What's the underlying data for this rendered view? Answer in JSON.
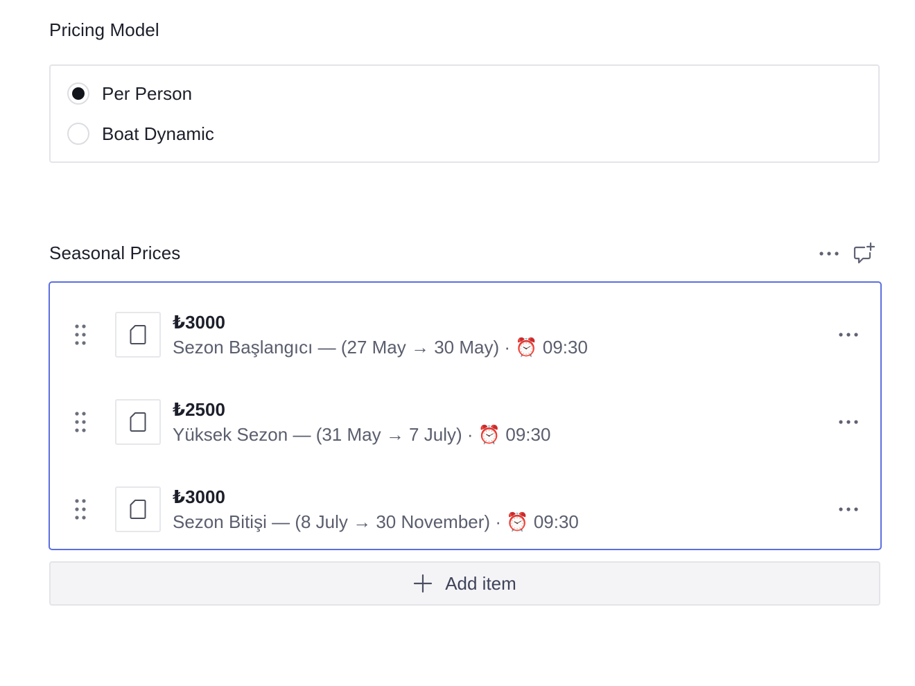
{
  "pricing": {
    "label": "Pricing Model",
    "options": [
      {
        "label": "Per Person",
        "selected": true
      },
      {
        "label": "Boat Dynamic",
        "selected": false
      }
    ]
  },
  "seasonal": {
    "label": "Seasonal Prices",
    "items": [
      {
        "price": "₺3000",
        "name": "Sezon Başlangıcı",
        "range": "(27 May → 30 May)",
        "time": "09:30"
      },
      {
        "price": "₺2500",
        "name": "Yüksek Sezon",
        "range": "(31 May → 7 July)",
        "time": "09:30"
      },
      {
        "price": "₺3000",
        "name": "Sezon Bitişi",
        "range": "(8 July → 30 November)",
        "time": "09:30"
      }
    ],
    "add_label": "Add item"
  },
  "icons": {
    "clock": "alarm-clock-icon",
    "drag": "drag-handle-icon",
    "document": "document-icon",
    "more": "more-icon",
    "comment": "add-comment-icon",
    "plus": "plus-icon"
  },
  "colors": {
    "accent_border": "#5b6ee0",
    "radio_selected": "#12141c"
  }
}
